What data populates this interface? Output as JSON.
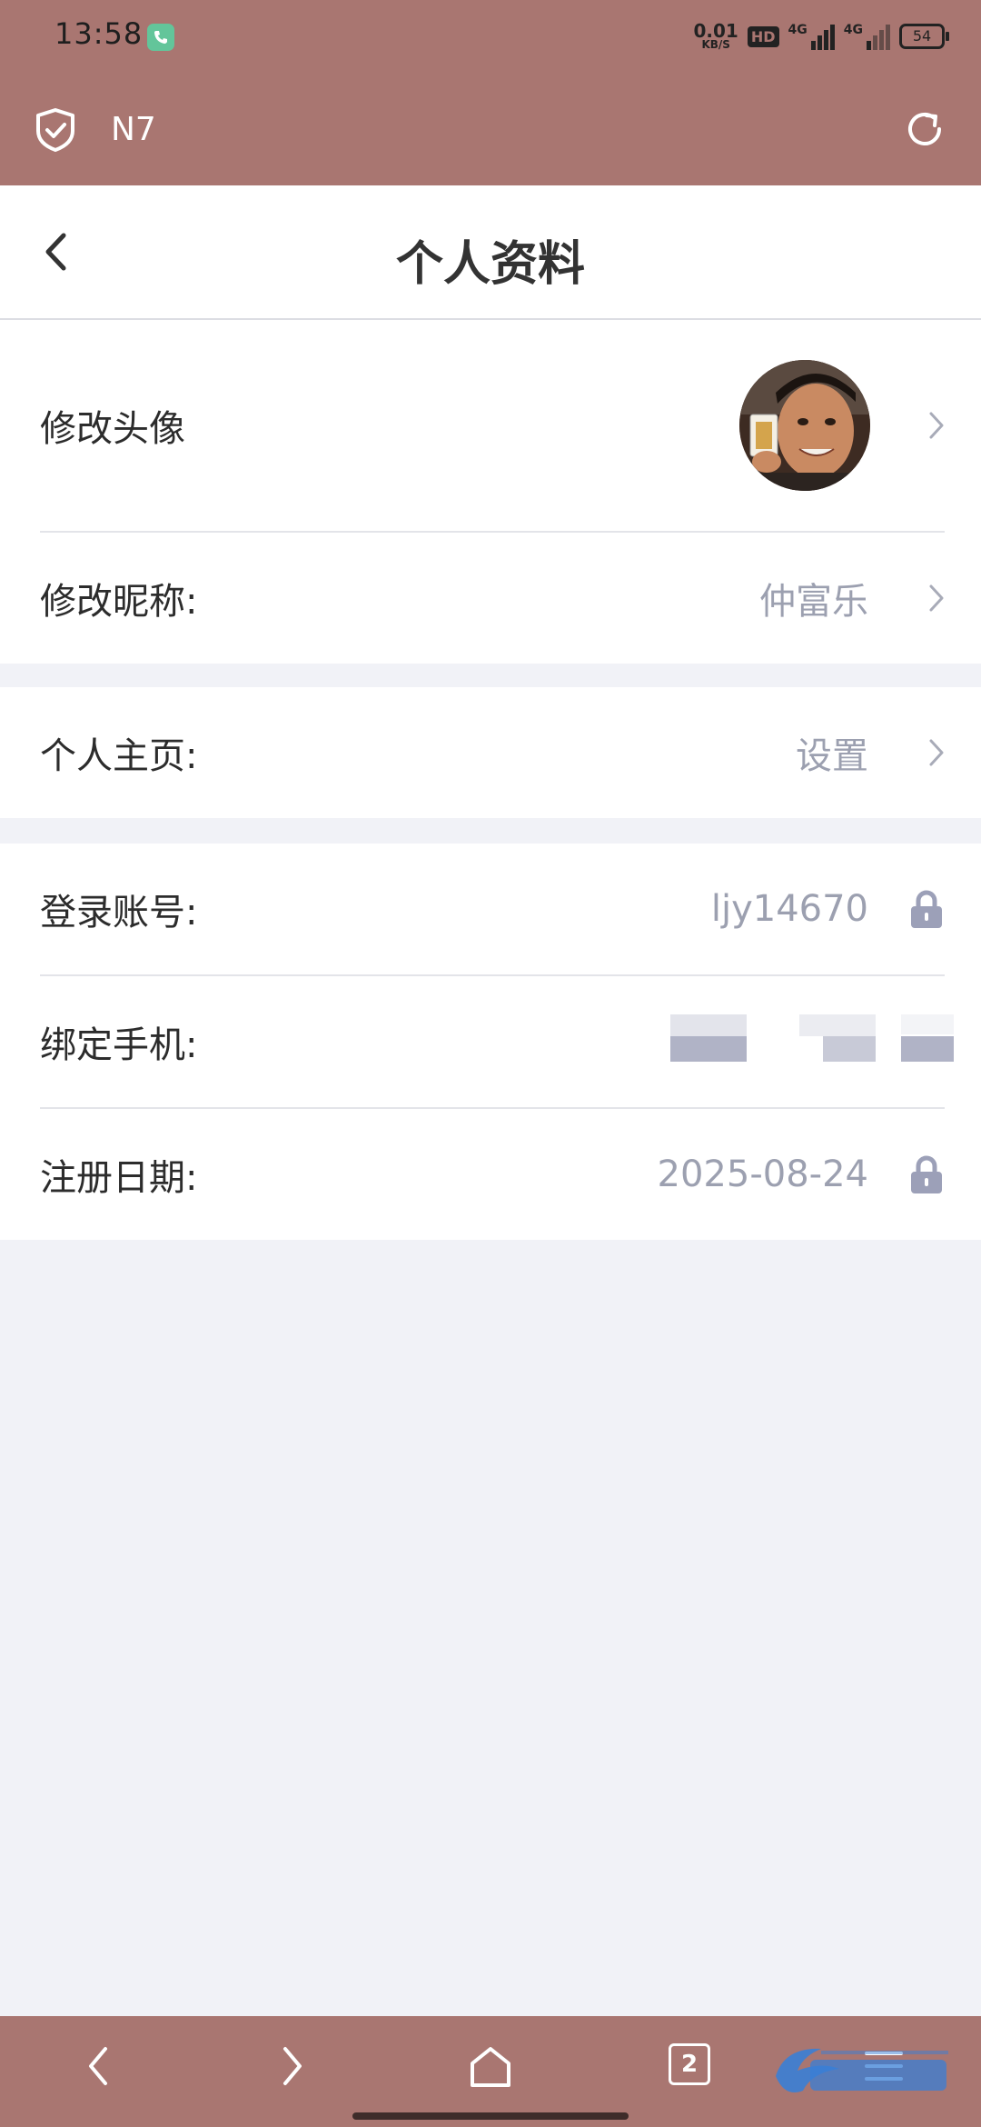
{
  "status_bar": {
    "time": "13:58",
    "net_speed_value": "0.01",
    "net_speed_unit": "KB/S",
    "hd_label": "HD",
    "signal1_label": "4G",
    "signal2_label": "4G",
    "battery": "54"
  },
  "browser": {
    "title": "N7"
  },
  "header": {
    "title": "个人资料"
  },
  "profile": {
    "avatar_label": "修改头像",
    "nickname_label": "修改昵称:",
    "nickname_value": "仲富乐"
  },
  "homepage": {
    "label": "个人主页:",
    "value": "设置"
  },
  "account": {
    "login_label": "登录账号:",
    "login_value": "ljy14670",
    "phone_label": "绑定手机:",
    "register_label": "注册日期:",
    "register_value": "2025-08-24"
  },
  "nav": {
    "tab_count": "2"
  },
  "colors": {
    "chrome": "#a97671",
    "background": "#f1f2f7",
    "value_text": "#9ca0b0"
  },
  "icons": [
    "call-icon",
    "shield-icon",
    "refresh-icon",
    "back-icon",
    "chevron-right-icon",
    "lock-icon",
    "nav-back-icon",
    "nav-forward-icon",
    "home-icon",
    "tabs-icon",
    "menu-icon"
  ]
}
